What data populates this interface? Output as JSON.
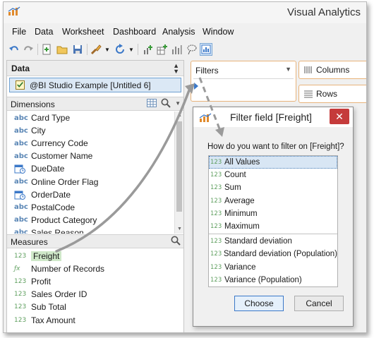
{
  "app": {
    "title": "Visual Analytics",
    "menu": [
      "File",
      "Data",
      "Worksheet",
      "Dashboard",
      "Analysis",
      "Window"
    ]
  },
  "data_panel": {
    "header": "Data",
    "datasource": "@BI Studio Example [Untitled 6]"
  },
  "dimensions": {
    "header": "Dimensions",
    "items": [
      {
        "type": "abc",
        "label": "Card Type"
      },
      {
        "type": "abc",
        "label": "City"
      },
      {
        "type": "abc",
        "label": "Currency Code"
      },
      {
        "type": "abc",
        "label": "Customer Name"
      },
      {
        "type": "date",
        "label": "DueDate"
      },
      {
        "type": "abc",
        "label": "Online Order Flag"
      },
      {
        "type": "date",
        "label": "OrderDate"
      },
      {
        "type": "abc",
        "label": "PostalCode"
      },
      {
        "type": "abc",
        "label": "Product Category"
      },
      {
        "type": "abc",
        "label": "Sales Reason"
      }
    ]
  },
  "measures": {
    "header": "Measures",
    "items": [
      {
        "type": "123",
        "label": "Freight"
      },
      {
        "type": "fx",
        "label": "Number of Records"
      },
      {
        "type": "123",
        "label": "Profit"
      },
      {
        "type": "123",
        "label": "Sales Order ID"
      },
      {
        "type": "123",
        "label": "Sub Total"
      },
      {
        "type": "123",
        "label": "Tax Amount"
      }
    ]
  },
  "shelves": {
    "filters": "Filters",
    "columns": "Columns",
    "rows": "Rows"
  },
  "dialog": {
    "title": "Filter field [Freight]",
    "question": "How do you want to filter on [Freight]?",
    "type_label": "123",
    "options_basic": [
      "All Values",
      "Count",
      "Sum",
      "Average",
      "Minimum",
      "Maximum"
    ],
    "options_advanced": [
      "Standard deviation",
      "Standard deviation (Population)",
      "Variance",
      "Variance (Population)"
    ],
    "selected": "All Values",
    "choose_label": "Choose",
    "cancel_label": "Cancel",
    "close_glyph": "✕"
  },
  "colors": {
    "accent": "#3b78c8",
    "shelf_border": "#e8b37a",
    "close_button": "#c53b3b",
    "measure_highlight": "#cfe8c9"
  }
}
